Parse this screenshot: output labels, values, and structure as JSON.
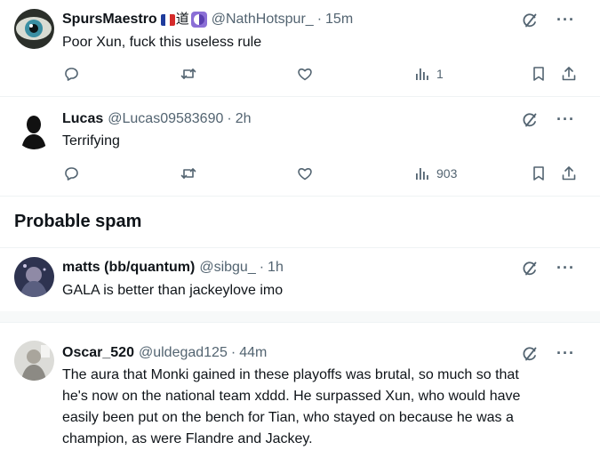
{
  "tweets": [
    {
      "name": "SpursMaestro",
      "badge_text": "道",
      "handle": "@NathHotspur_",
      "separator": "·",
      "time": "15m",
      "text": "Poor Xun, fuck this useless rule",
      "views": "1"
    },
    {
      "name": "Lucas",
      "handle": "@Lucas09583690",
      "separator": "·",
      "time": "2h",
      "text": "Terrifying",
      "views": "903"
    }
  ],
  "section": {
    "title": "Probable spam"
  },
  "spam_tweets": [
    {
      "name": "matts (bb/quantum)",
      "handle": "@sibgu_",
      "separator": "·",
      "time": "1h",
      "text": "GALA is better than jackeylove imo"
    },
    {
      "name": "Oscar_520",
      "handle": "@uldegad125",
      "separator": "·",
      "time": "44m",
      "text_lines": [
        "The aura that Monki gained in these playoffs was brutal, so much so that",
        "he's now on the national team xddd. He surpassed Xun, who would have",
        "easily been put on the bench  for Tian, who stayed on because he was a",
        "champion, as were Flandre and Jackey."
      ]
    }
  ],
  "more_label": "···",
  "colors": {
    "text": "#0f1419",
    "secondary": "#536471",
    "divider": "#eff3f4",
    "gap": "#f7f9f9"
  },
  "icons": [
    "reply-icon",
    "retweet-icon",
    "like-icon",
    "views-icon",
    "bookmark-icon",
    "share-icon",
    "grok-icon",
    "more-icon"
  ]
}
